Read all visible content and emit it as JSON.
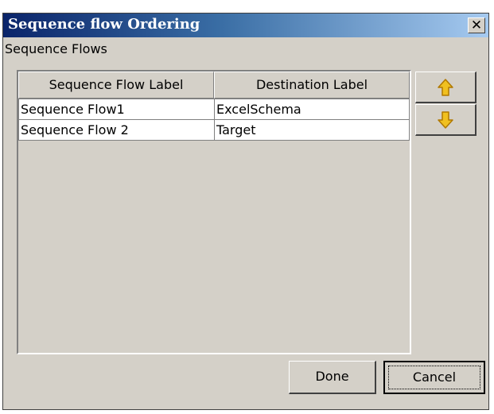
{
  "dialog": {
    "title": "Sequence flow Ordering",
    "close_glyph": "✕",
    "section_label": "Sequence Flows"
  },
  "table": {
    "columns": [
      "Sequence Flow Label",
      "Destination Label"
    ],
    "rows": [
      [
        "Sequence Flow1",
        "ExcelSchema"
      ],
      [
        "Sequence Flow 2",
        "Target"
      ]
    ]
  },
  "side_buttons": {
    "up_icon": "arrow-up-icon",
    "down_icon": "arrow-down-icon",
    "arrow_color": "#f0c020"
  },
  "buttons": {
    "done": "Done",
    "cancel": "Cancel"
  }
}
